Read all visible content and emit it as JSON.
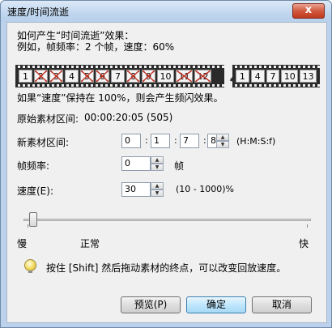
{
  "window": {
    "title": "速度/时间流逝",
    "close_label": "x"
  },
  "intro": {
    "line1": "如何产生“时间流逝”效果：",
    "line2": "例如，帧频率：2 个帧，速度：60%"
  },
  "film_before": [
    {
      "label": "1",
      "crossed": false
    },
    {
      "label": "2",
      "crossed": true
    },
    {
      "label": "3",
      "crossed": true
    },
    {
      "label": "4",
      "crossed": false
    },
    {
      "label": "5",
      "crossed": true
    },
    {
      "label": "6",
      "crossed": true
    },
    {
      "label": "7",
      "crossed": false
    },
    {
      "label": "8",
      "crossed": true
    },
    {
      "label": "9",
      "crossed": true
    },
    {
      "label": "10",
      "crossed": false
    },
    {
      "label": "11",
      "crossed": true
    },
    {
      "label": "12",
      "crossed": true
    }
  ],
  "film_after": [
    "1",
    "4",
    "7",
    "10",
    "13"
  ],
  "note_100": "如果“速度”保持在 100%，则会产生频闪效果。",
  "original_range": {
    "label": "原始素材区间:",
    "value": "00:00:20:05 (505)"
  },
  "new_range": {
    "label": "新素材区间:",
    "h": "0",
    "m": "1",
    "s": "7",
    "f": "8",
    "format": "(H:M:S:f)"
  },
  "frame_rate": {
    "label": "帧频率:",
    "value": "0",
    "unit": "帧"
  },
  "speed": {
    "label": "速度(E):",
    "value": "30",
    "range": "(10 - 1000)%"
  },
  "slider": {
    "label_slow": "慢",
    "label_normal": "正常",
    "label_fast": "快",
    "value_fraction": 0.02
  },
  "tip": "按住 [Shift] 然后拖动素材的终点，可以改变回放速度。",
  "buttons": {
    "preview": "预览(P)",
    "ok": "确定",
    "cancel": "取消"
  }
}
